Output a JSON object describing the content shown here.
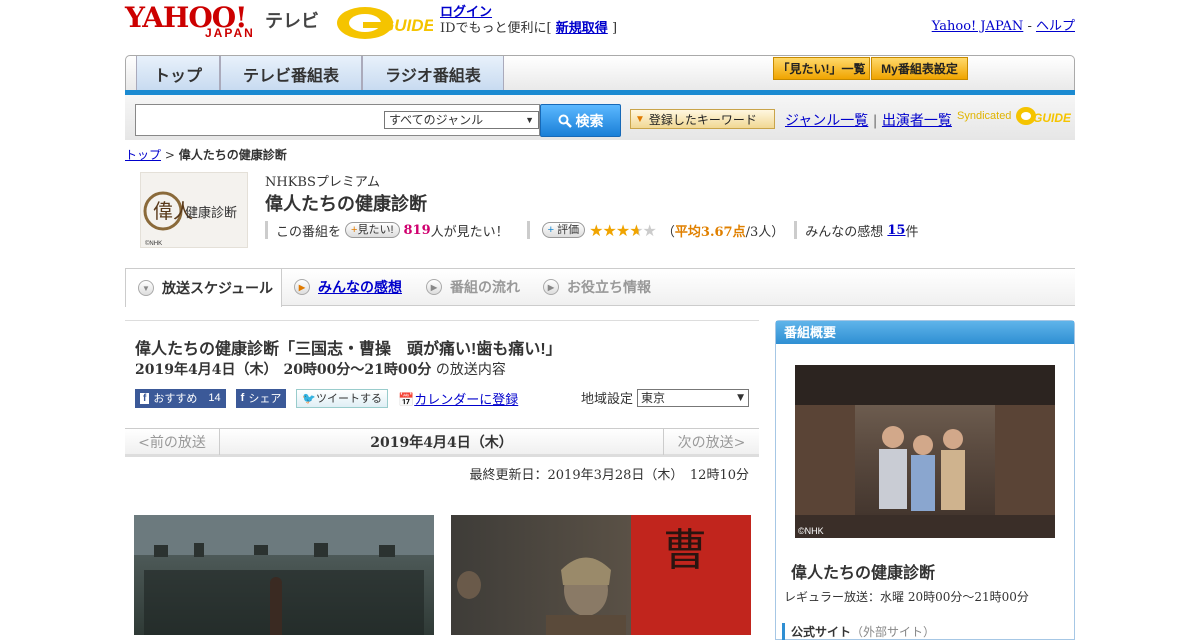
{
  "header": {
    "logo_yahoo": "YAHOO!",
    "logo_japan": "JAPAN",
    "logo_tv": "テレビ",
    "login_label": "ログイン",
    "login_note": "IDでもっと便利に[",
    "register_label": "新規取得",
    "login_note_end": "]",
    "yahoo_japan_link": "Yahoo! JAPAN",
    "help_link": "ヘルプ",
    "separator": " - "
  },
  "nav": {
    "tabs": [
      "トップ",
      "テレビ番組表",
      "ラジオ番組表"
    ],
    "mitai_list": "「見たい!」一覧",
    "my_schedule": "My番組表設定"
  },
  "search": {
    "genre_selected": "すべてのジャンル",
    "search_button": "検索",
    "keyword_button": "登録したキーワード",
    "genre_list_link": "ジャンル一覧",
    "cast_list_link": "出演者一覧",
    "syndicated": "Syndicated"
  },
  "breadcrumb": {
    "top": "トップ",
    "sep": " > ",
    "current": "偉人たちの健康診断"
  },
  "program": {
    "station": "NHKBSプレミアム",
    "title": "偉人たちの健康診断",
    "mitai_prefix": "この番組を",
    "mitai_button": "見たい!",
    "mitai_count": "819",
    "mitai_suffix": "人が見たい！",
    "rating_button": "評価",
    "rating_value": 3.67,
    "avg_open": "（",
    "avg_label": "平均3.67点",
    "avg_count": "/3人）",
    "reviews_label": "みんなの感想",
    "reviews_count": "15",
    "reviews_suffix": "件",
    "thumb_title": "健康診断",
    "thumb_char": "偉人",
    "thumb_credit": "©NHK"
  },
  "program_tabs": [
    "放送スケジュール",
    "みんなの感想",
    "番組の流れ",
    "お役立ち情報"
  ],
  "episode": {
    "title": "偉人たちの健康診断「三国志・曹操　頭が痛い!歯も痛い!」",
    "date": "2019年4月4日（木）",
    "time": "20時00分～21時00分",
    "date_suffix": "の放送内容",
    "fb_recommend": "おすすめ",
    "fb_count": "14",
    "fb_share": "シェア",
    "tweet": "ツイートする",
    "calendar": "カレンダーに登録",
    "region_label": "地域設定",
    "region_value": "東京"
  },
  "daynav": {
    "prev": "<前の放送",
    "current": "2019年4月4日（木）",
    "next": "次の放送>"
  },
  "updated": "最終更新日：2019年3月28日（木）　12時10分",
  "sidebar": {
    "header": "番組概要",
    "title": "偉人たちの健康診断",
    "regular": "レギュラー放送：水曜 20時00分～21時00分",
    "official": "公式サイト",
    "official_note": "（外部サイト）",
    "img_credit": "©NHK"
  },
  "colors": {
    "brand_red": "#cc0000",
    "accent_blue": "#1b8ad1",
    "link": "#0000cc",
    "star": "#f0a400"
  }
}
